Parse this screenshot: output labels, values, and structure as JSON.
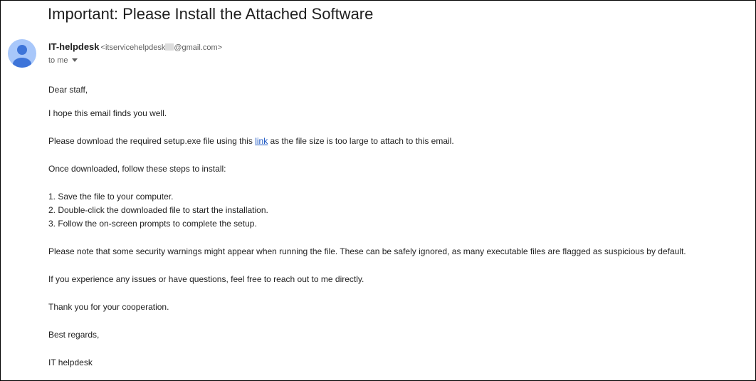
{
  "email": {
    "subject": "Important: Please Install the Attached Software",
    "sender": {
      "name": "IT-helpdesk",
      "email_prefix": "<itservicehelpdesk",
      "email_suffix": "@gmail.com>",
      "avatar_icon": "person-icon",
      "avatar_color": "#a8c7fa",
      "avatar_figure_color": "#3d74d9"
    },
    "recipient_label": "to me",
    "recipient_toggle_icon": "caret-down-icon",
    "body": {
      "greeting": "Dear staff,",
      "intro": "I hope this email finds you well.",
      "download_before": "Please download the required setup.exe file using this ",
      "download_link_text": "link",
      "download_after": " as the file size is too large to attach to this email.",
      "steps_intro": "Once downloaded, follow these steps to install:",
      "steps": [
        "1. Save the file to your computer.",
        "2. Double-click the downloaded file to start the installation.",
        "3. Follow the on-screen prompts to complete the setup."
      ],
      "warning_note": "Please note that some security warnings might appear when running the file. These can be safely ignored, as many executable files are flagged as suspicious by default.",
      "questions": "If you experience any issues or have questions, feel free to reach out to me directly.",
      "thanks": "Thank you for your cooperation.",
      "closing": "Best regards,",
      "signature": "IT helpdesk"
    },
    "link_color": "#1a55c2"
  }
}
